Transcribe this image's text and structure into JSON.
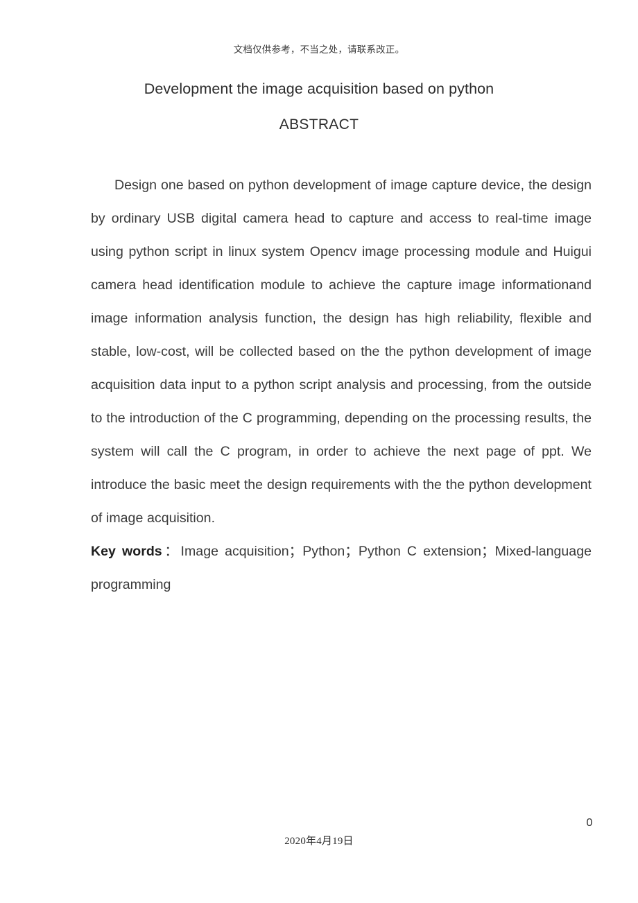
{
  "header": {
    "disclaimer": "文档仅供参考，不当之处，请联系改正。"
  },
  "title": {
    "main": "Development the image acquisition based on python",
    "section": "ABSTRACT"
  },
  "abstract": {
    "paragraph": "Design one based on python development of image capture device, the design by ordinary USB digital camera head to capture and access to real-time image using python script in linux system Opencv image processing module and Huigui camera head identification module to achieve the capture image informationand image information analysis function, the design has high reliability, flexible and stable, low-cost, will be collected based on the the python development of image acquisition data input to a python script analysis and processing, from the outside to the introduction of the C programming, depending on the processing results, the system will call the C program, in order to achieve the next page of ppt. We introduce the basic meet the design requirements with the the python development of image acquisition."
  },
  "keywords": {
    "label": "Key words",
    "separator": "：",
    "text": "Image acquisition；Python；Python C extension；Mixed-language programming"
  },
  "footer": {
    "page_number": "0",
    "date": "2020年4月19日"
  },
  "colors": {
    "text": "#3a3a3a",
    "title": "#2b2b2b",
    "background": "#ffffff"
  }
}
